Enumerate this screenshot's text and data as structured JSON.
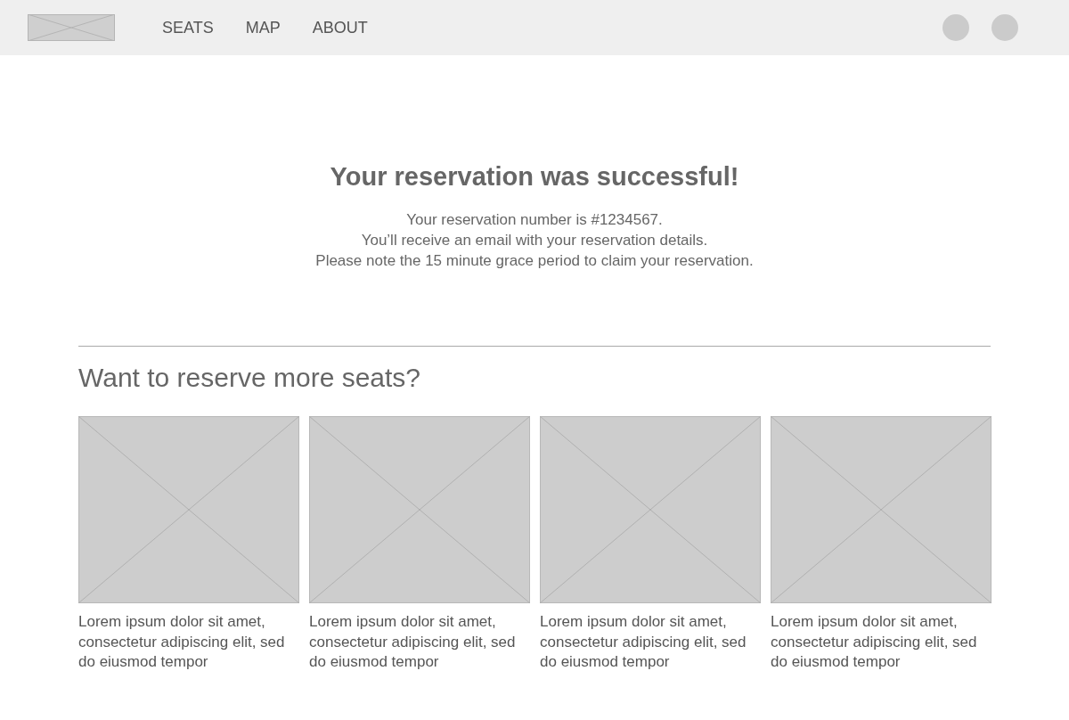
{
  "nav": {
    "items": [
      "SEATS",
      "MAP",
      "ABOUT"
    ]
  },
  "confirmation": {
    "title": "Your reservation was successful!",
    "lines": [
      "Your reservation number is #1234567.",
      "You’ll receive an email with your reservation details.",
      "Please note the 15 minute grace period to claim your reservation."
    ]
  },
  "more": {
    "heading": "Want to reserve more seats?",
    "cards": [
      {
        "caption": "Lorem ipsum dolor sit amet, consectetur adipiscing elit, sed do eiusmod tempor"
      },
      {
        "caption": "Lorem ipsum dolor sit amet, consectetur adipiscing elit, sed do eiusmod tempor"
      },
      {
        "caption": "Lorem ipsum dolor sit amet, consectetur adipiscing elit, sed do eiusmod tempor"
      },
      {
        "caption": "Lorem ipsum dolor sit amet, consectetur adipiscing elit, sed do eiusmod tempor"
      }
    ]
  }
}
